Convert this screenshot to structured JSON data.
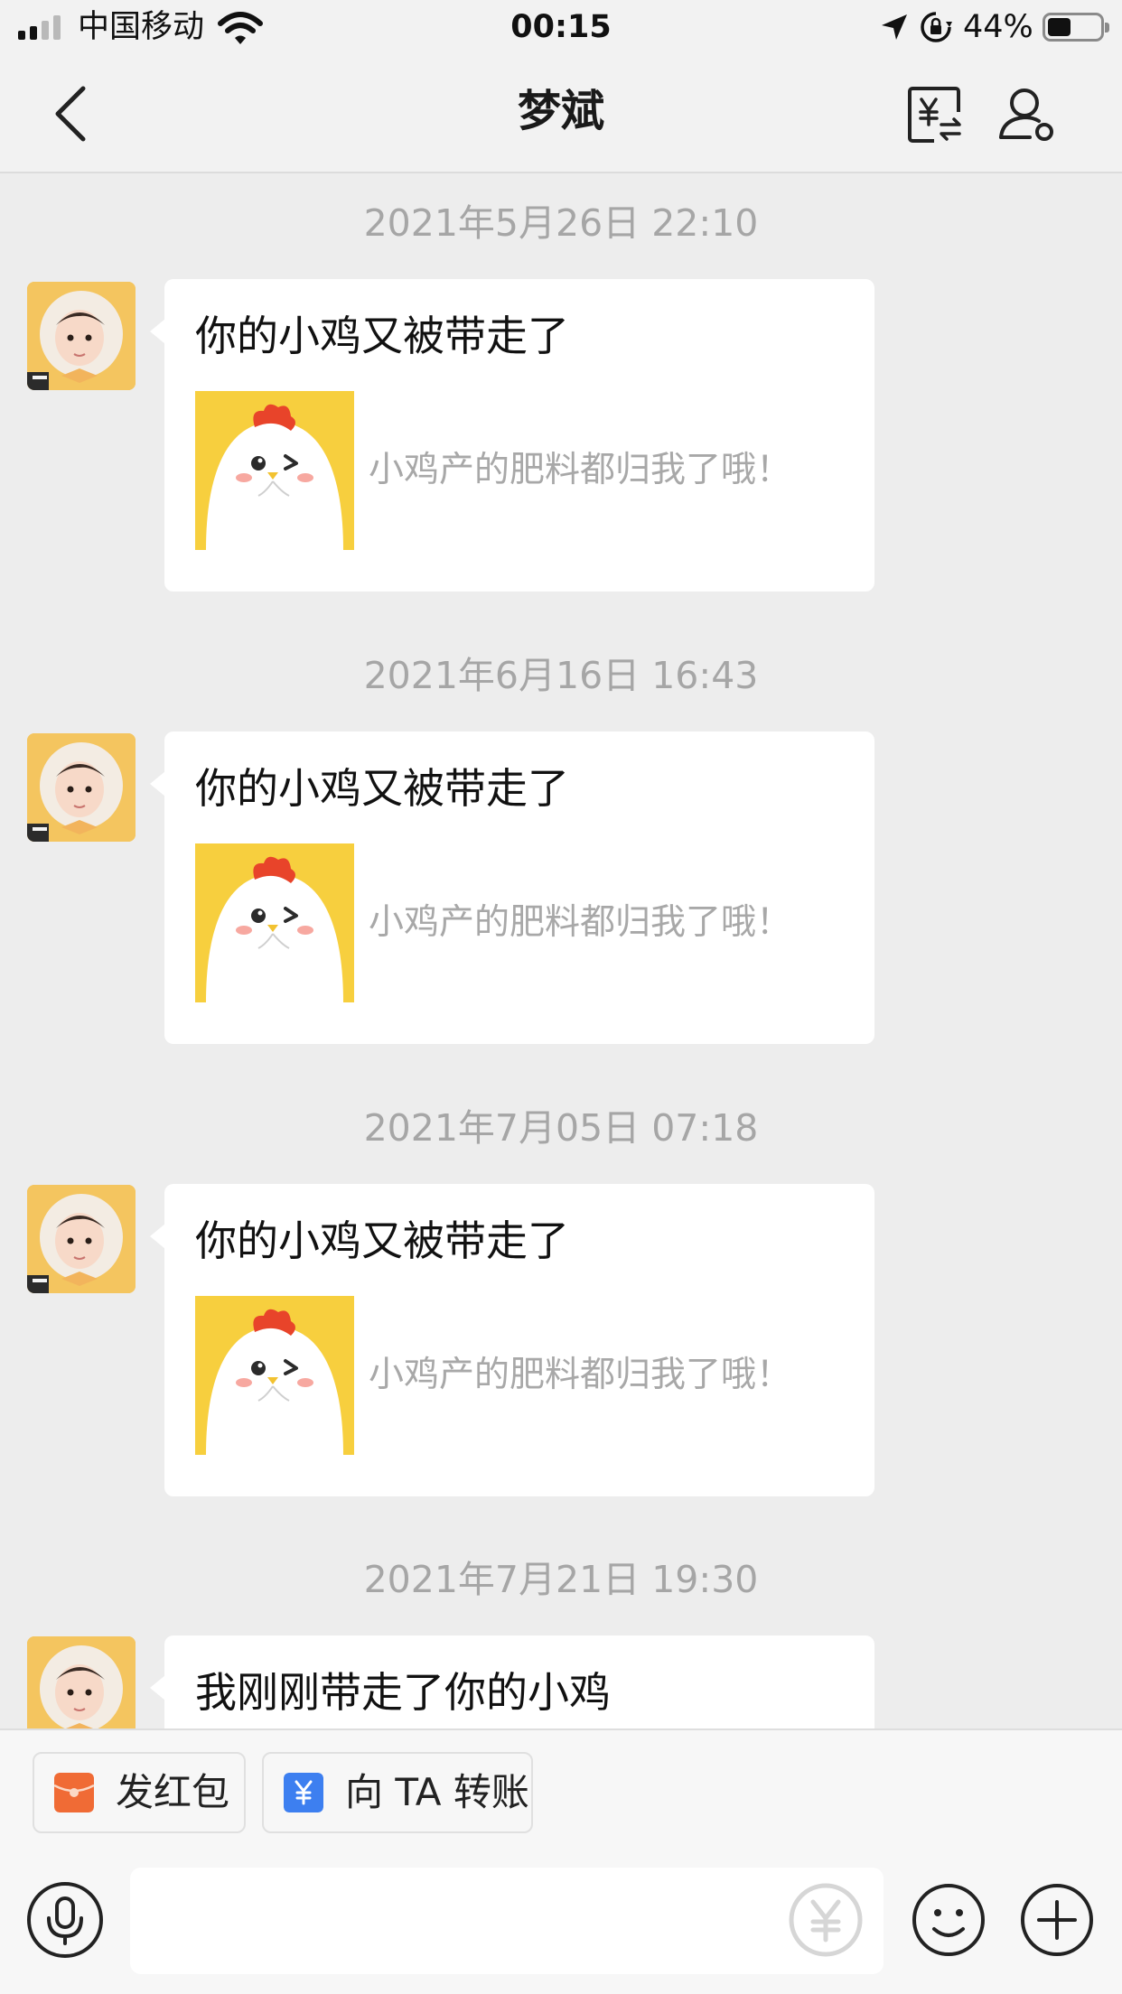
{
  "status_bar": {
    "carrier": "中国移动",
    "time": "00:15",
    "battery_percent": "44%",
    "battery_level": 0.44
  },
  "nav": {
    "title": "梦斌"
  },
  "messages": [
    {
      "timestamp": "2021年5月26日 22:10",
      "title": "你的小鸡又被带走了",
      "card_text": "小鸡产的肥料都归我了哦！"
    },
    {
      "timestamp": "2021年6月16日 16:43",
      "title": "你的小鸡又被带走了",
      "card_text": "小鸡产的肥料都归我了哦！"
    },
    {
      "timestamp": "2021年7月05日 07:18",
      "title": "你的小鸡又被带走了",
      "card_text": "小鸡产的肥料都归我了哦！"
    },
    {
      "timestamp": "2021年7月21日 19:30",
      "title": "我刚刚带走了你的小鸡"
    }
  ],
  "bottom_bar": {
    "red_packet_label": "发红包",
    "transfer_label": "向 TA 转账"
  },
  "colors": {
    "background": "#ededed",
    "red_packet_icon": "#f06b35",
    "transfer_icon": "#3d7ff0",
    "card_thumb_bg": "#f7cf3e"
  },
  "icons": [
    "signal-icon",
    "wifi-icon",
    "location-arrow-icon",
    "rotation-lock-icon",
    "battery-icon",
    "back-chevron-icon",
    "yuan-transfer-history-icon",
    "user-settings-icon",
    "red-packet-icon",
    "yuan-transfer-icon",
    "voice-icon",
    "yuan-icon",
    "emoji-icon",
    "plus-icon"
  ]
}
